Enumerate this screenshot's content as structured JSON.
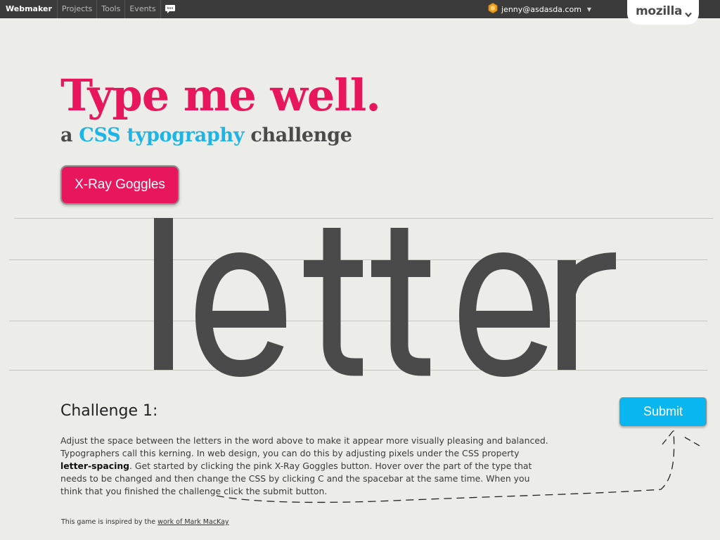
{
  "nav": {
    "brand": "Webmaker",
    "items": [
      "Projects",
      "Tools",
      "Events"
    ],
    "chat_icon": "chat-bubble-icon",
    "user_email": "jenny@asdasda.com",
    "user_icon": "hexagon-badge-icon",
    "mozilla_label": "mozilla"
  },
  "header": {
    "title": "Type me well.",
    "subtitle_prefix": "a ",
    "subtitle_highlight": "CSS typography",
    "subtitle_suffix": " challenge"
  },
  "xray_button": "X-Ray Goggles",
  "specimen": {
    "letters": [
      "l",
      "e",
      "t",
      "t",
      "e",
      "r"
    ]
  },
  "challenge": {
    "title": "Challenge 1:",
    "text_1": "Adjust the space between the letters in the word above to make it appear more visually pleasing and balanced. Typographers call this kerning. In web design, you can do this by adjusting pixels under the CSS property ",
    "property": "letter-spacing",
    "text_2": ". Get started by clicking the pink X-Ray Goggles button. Hover over the part of the type that needs to be changed and then change the CSS by clicking C and the spacebar at the same time. When you think that you finished the challenge click the submit button."
  },
  "submit_button": "Submit",
  "credit": {
    "prefix": "This game is inspired by the ",
    "link": "work of Mark MacKay"
  },
  "colors": {
    "accent_pink": "#e8175d",
    "accent_blue": "#1fb4e6",
    "submit_blue": "#0ab6ef",
    "background": "#ecede8",
    "letter_gray": "#4a4a4a"
  }
}
